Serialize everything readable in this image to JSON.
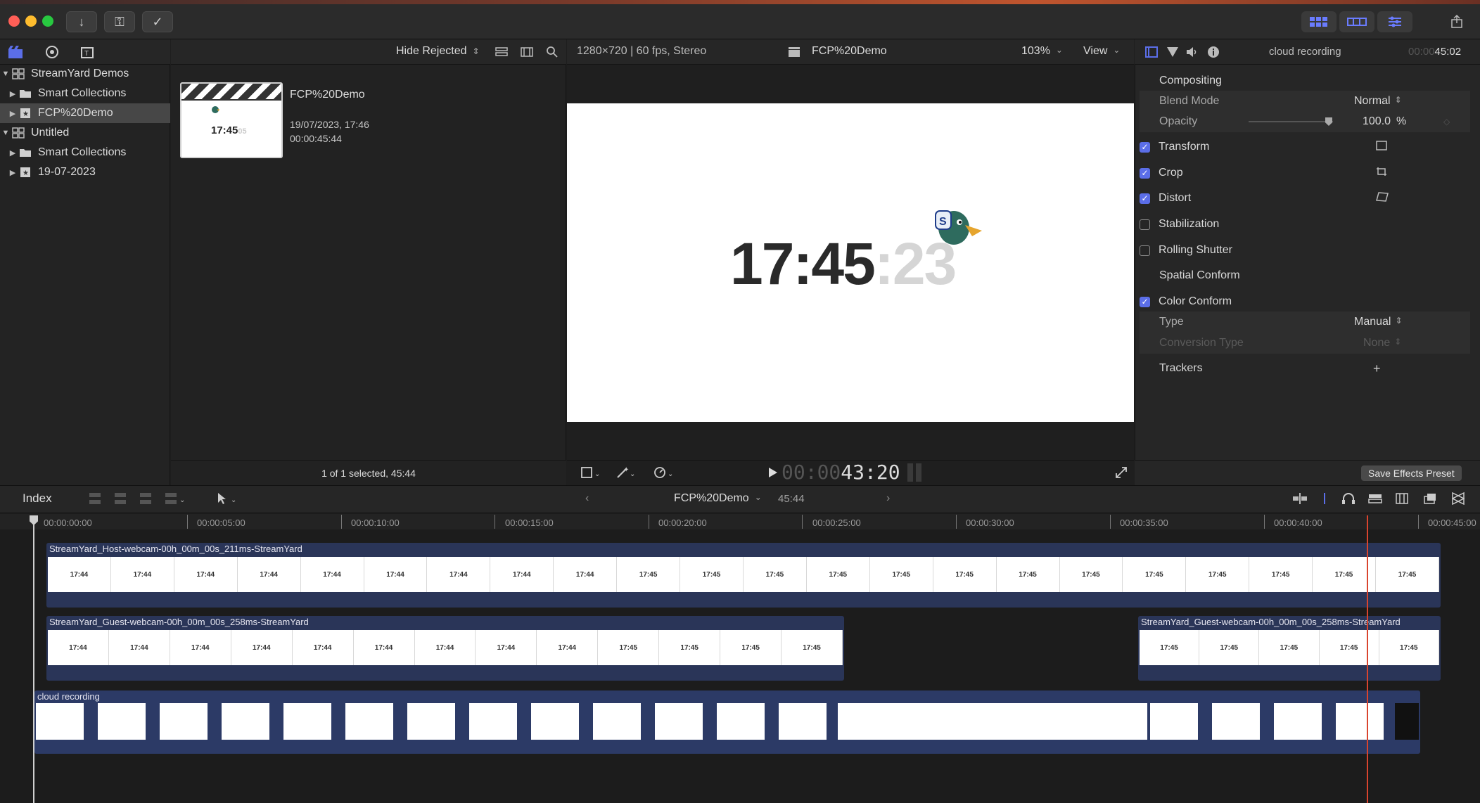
{
  "window": {
    "toolbar_icons": [
      "download-icon",
      "key-icon",
      "checkmark-circle-icon"
    ],
    "right_icons": [
      "browser-toggle-icon",
      "timeline-toggle-icon",
      "inspector-toggle-icon",
      "share-icon"
    ]
  },
  "sidebar": {
    "top_icons": [
      "libraries-icon",
      "photos-audio-icon",
      "titles-generators-icon"
    ],
    "items": [
      {
        "label": "StreamYard Demos",
        "level": 0,
        "expanded": true,
        "icon": "library-icon"
      },
      {
        "label": "Smart Collections",
        "level": 1,
        "expanded": false,
        "icon": "folder-icon"
      },
      {
        "label": "FCP%20Demo",
        "level": 1,
        "expanded": false,
        "icon": "event-icon",
        "selected": true
      },
      {
        "label": "Untitled",
        "level": 0,
        "expanded": true,
        "icon": "library-icon"
      },
      {
        "label": "Smart Collections",
        "level": 1,
        "expanded": false,
        "icon": "folder-icon"
      },
      {
        "label": "19-07-2023",
        "level": 1,
        "expanded": false,
        "icon": "event-icon"
      }
    ]
  },
  "browser": {
    "filter_label": "Hide Rejected",
    "clip": {
      "name": "FCP%20Demo",
      "date": "19/07/2023, 17:46",
      "duration": "00:00:45:44",
      "thumb_time": "17:45",
      "thumb_seconds": "05"
    },
    "status": "1 of 1 selected, 45:44"
  },
  "viewer": {
    "format": "1280×720 | 60 fps, Stereo",
    "project": "FCP%20Demo",
    "zoom": "103%",
    "view_label": "View",
    "clock_main": "17:45",
    "clock_seconds": ":23",
    "timecode_dim": "00:00",
    "timecode": "43:20"
  },
  "inspector": {
    "clip_name": "cloud recording",
    "duration_dim": "00:00",
    "duration": "45:02",
    "compositing": "Compositing",
    "blend_mode_label": "Blend Mode",
    "blend_mode_value": "Normal",
    "opacity_label": "Opacity",
    "opacity_value": "100.0",
    "opacity_unit": "%",
    "sections": [
      {
        "label": "Transform",
        "checked": true
      },
      {
        "label": "Crop",
        "checked": true
      },
      {
        "label": "Distort",
        "checked": true
      },
      {
        "label": "Stabilization",
        "checked": false
      },
      {
        "label": "Rolling Shutter",
        "checked": false
      }
    ],
    "spatial_conform": "Spatial Conform",
    "color_conform": "Color Conform",
    "type_label": "Type",
    "type_value": "Manual",
    "conversion_label": "Conversion Type",
    "conversion_value": "None",
    "trackers": "Trackers",
    "save_preset": "Save Effects Preset"
  },
  "timeline": {
    "index_label": "Index",
    "project": "FCP%20Demo",
    "duration": "45:44",
    "ruler": [
      "00:00:00:00",
      "00:00:05:00",
      "00:00:10:00",
      "00:00:15:00",
      "00:00:20:00",
      "00:00:25:00",
      "00:00:30:00",
      "00:00:35:00",
      "00:00:40:00",
      "00:00:45:00"
    ],
    "clips": {
      "host": "StreamYard_Host-webcam-00h_00m_00s_211ms-StreamYard",
      "guest_a": "StreamYard_Guest-webcam-00h_00m_00s_258ms-StreamYard",
      "guest_b": "StreamYard_Guest-webcam-00h_00m_00s_258ms-StreamYard",
      "main": "cloud recording"
    },
    "frame_labels_host": [
      "17:44",
      "17:44",
      "17:44",
      "17:44",
      "17:44",
      "17:44",
      "17:44",
      "17:44",
      "17:44",
      "17:45",
      "17:45",
      "17:45",
      "17:45",
      "17:45",
      "17:45",
      "17:45",
      "17:45",
      "17:45",
      "17:45",
      "17:45",
      "17:45",
      "17:45"
    ],
    "frame_labels_guest_a": [
      "17:44",
      "17:44",
      "17:44",
      "17:44",
      "17:44",
      "17:44",
      "17:44",
      "17:44",
      "17:44",
      "17:45",
      "17:45",
      "17:45",
      "17:45"
    ],
    "frame_labels_guest_b": [
      "17:45",
      "17:45",
      "17:45",
      "17:45",
      "17:45"
    ]
  },
  "colors": {
    "accent": "#5b6ee8",
    "playhead": "#d9442e",
    "clip_blue": "#2a3558"
  }
}
